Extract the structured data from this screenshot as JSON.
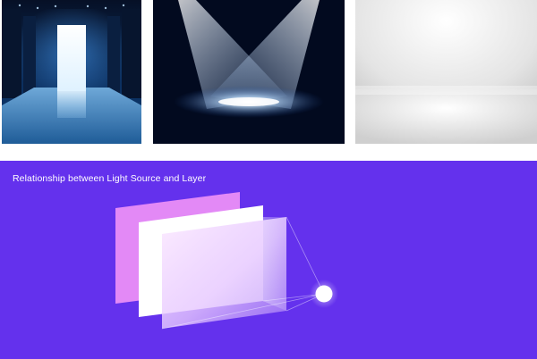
{
  "diagram": {
    "title": "Relationship between Light Source and Layer",
    "colors": {
      "background": "#6431ED",
      "back_layer": "#E389F6",
      "middle_layer": "#FFFFFF",
      "front_layer": "#F4E6FF",
      "light_source": "#FFFFFF"
    }
  }
}
